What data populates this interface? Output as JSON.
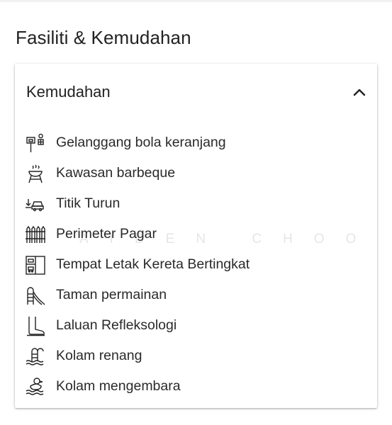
{
  "section": {
    "title": "Fasiliti & Kemudahan"
  },
  "card": {
    "title": "Kemudahan",
    "toggle_icon": "chevron-up-icon",
    "items": [
      {
        "label": "Gelanggang bola keranjang",
        "icon": "basketball-hoop-icon"
      },
      {
        "label": "Kawasan barbeque",
        "icon": "barbecue-grill-icon"
      },
      {
        "label": "Titik Turun",
        "icon": "drop-off-car-icon"
      },
      {
        "label": "Perimeter Pagar",
        "icon": "fence-icon"
      },
      {
        "label": "Tempat Letak Kereta Bertingkat",
        "icon": "multi-storey-parking-icon"
      },
      {
        "label": "Taman permainan",
        "icon": "playground-slide-icon"
      },
      {
        "label": "Laluan Refleksologi",
        "icon": "reflexology-foot-icon"
      },
      {
        "label": "Kolam renang",
        "icon": "swimming-pool-icon"
      },
      {
        "label": "Kolam mengembara",
        "icon": "wading-pool-icon"
      }
    ]
  },
  "watermark": "AIDEN CHOO"
}
